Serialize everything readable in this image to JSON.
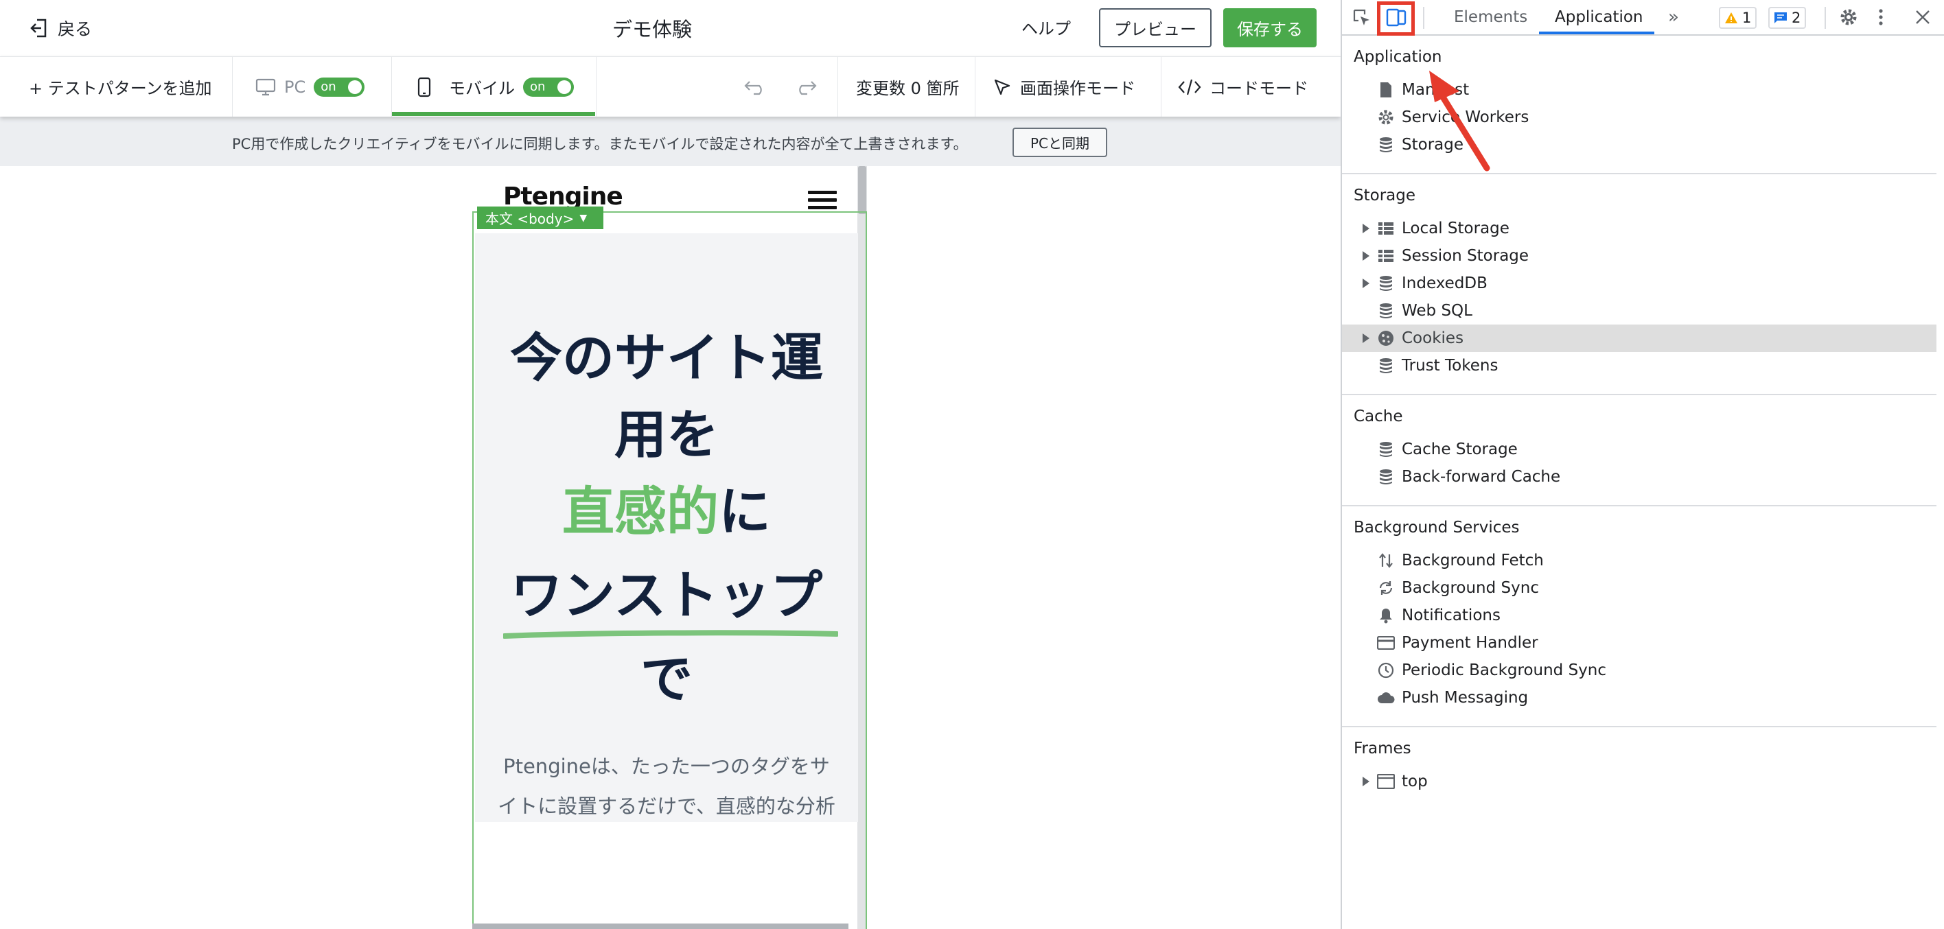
{
  "editor": {
    "back_label": "戻る",
    "title": "デモ体験",
    "help_label": "ヘルプ",
    "preview_label": "プレビュー",
    "save_label": "保存する",
    "colors": {
      "accent": "#4aa94b",
      "headline": "#12213b",
      "headline_green": "#6abf6a"
    }
  },
  "toolbar": {
    "add_pattern": "+ テストパターンを追加",
    "pc_label": "PC",
    "pc_toggle": "on",
    "mobile_label": "モバイル",
    "mobile_toggle": "on",
    "changes": "変更数 0 箇所",
    "screen_mode": "画面操作モード",
    "code_mode": "コードモード"
  },
  "notice": {
    "text": "PC用で作成したクリエイティブをモバイルに同期します。またモバイルで設定された内容が全て上書きされます。",
    "sync_button": "PCと同期"
  },
  "preview": {
    "logo": "Ptengine",
    "body_tag": "本文 <body>",
    "headline_1": "今のサイト運",
    "headline_2": "用を",
    "headline_3_green": "直感的",
    "headline_3_rest": "に",
    "headline_4": "ワンストップ",
    "headline_5": "で",
    "sub_1": "Ptengineは、たった一つのタグをサ",
    "sub_2": "イトに設置するだけで、直感的な分析"
  },
  "devtools": {
    "tabs": [
      "Elements",
      "Application"
    ],
    "active_tab": "Application",
    "warnings": "1",
    "messages": "2",
    "sections": {
      "application": {
        "title": "Application",
        "items": [
          "Manifest",
          "Service Workers",
          "Storage"
        ]
      },
      "storage": {
        "title": "Storage",
        "items": [
          "Local Storage",
          "Session Storage",
          "IndexedDB",
          "Web SQL",
          "Cookies",
          "Trust Tokens"
        ]
      },
      "cache": {
        "title": "Cache",
        "items": [
          "Cache Storage",
          "Back-forward Cache"
        ]
      },
      "background": {
        "title": "Background Services",
        "items": [
          "Background Fetch",
          "Background Sync",
          "Notifications",
          "Payment Handler",
          "Periodic Background Sync",
          "Push Messaging"
        ]
      },
      "frames": {
        "title": "Frames",
        "items": [
          "top"
        ]
      }
    }
  }
}
